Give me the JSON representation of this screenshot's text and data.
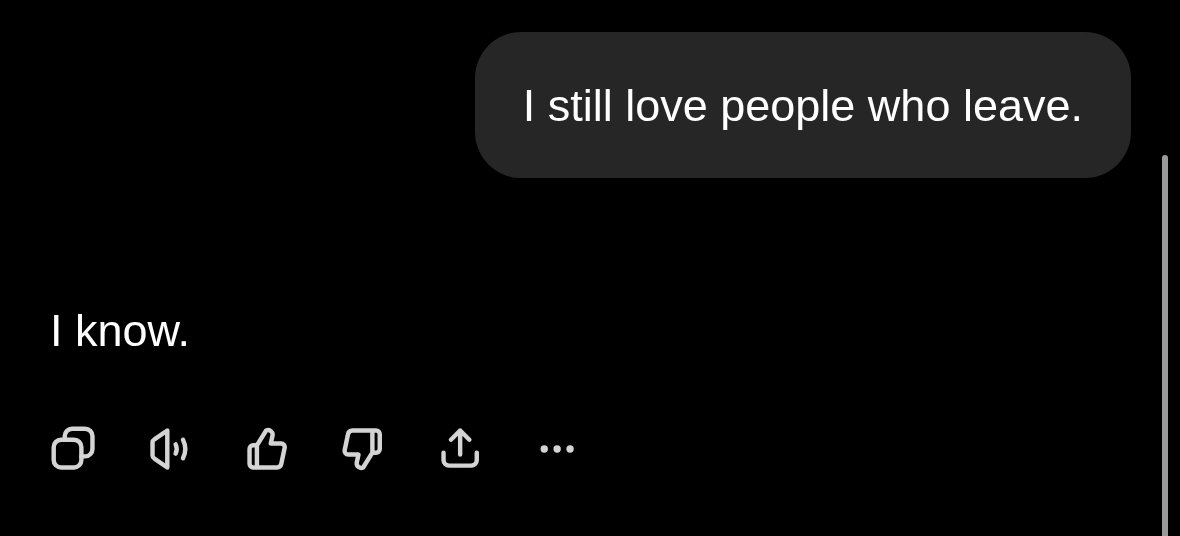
{
  "messages": [
    {
      "kind": "bubble",
      "text": "I still love people who leave."
    },
    {
      "kind": "plain",
      "text": "I know."
    }
  ],
  "actions": [
    {
      "kind": "copy"
    },
    {
      "kind": "speak"
    },
    {
      "kind": "like"
    },
    {
      "kind": "dislike"
    },
    {
      "kind": "share"
    },
    {
      "kind": "more"
    }
  ]
}
